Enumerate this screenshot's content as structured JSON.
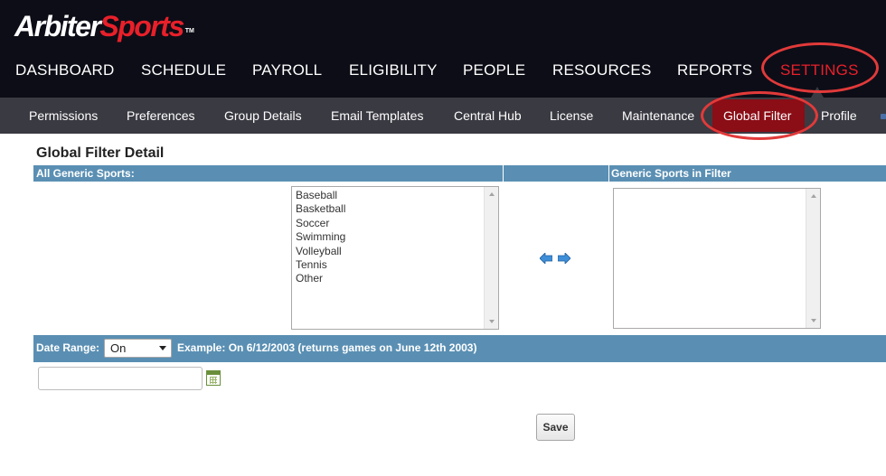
{
  "brand": {
    "part1": "Arbiter",
    "part2": "Sports",
    "tm": "TM"
  },
  "main_nav": [
    {
      "label": "DASHBOARD"
    },
    {
      "label": "SCHEDULE"
    },
    {
      "label": "PAYROLL"
    },
    {
      "label": "ELIGIBILITY"
    },
    {
      "label": "PEOPLE"
    },
    {
      "label": "RESOURCES"
    },
    {
      "label": "REPORTS"
    },
    {
      "label": "SETTINGS",
      "active": true
    }
  ],
  "sub_nav": [
    {
      "label": "Permissions"
    },
    {
      "label": "Preferences"
    },
    {
      "label": "Group Details"
    },
    {
      "label": "Email Templates"
    },
    {
      "label": "Central Hub"
    },
    {
      "label": "License"
    },
    {
      "label": "Maintenance"
    },
    {
      "label": "Global Filter",
      "active": true
    },
    {
      "label": "Profile"
    }
  ],
  "page": {
    "title": "Global Filter Detail",
    "left_header": "All Generic Sports:",
    "right_header": "Generic Sports in Filter",
    "available_sports": [
      "Baseball",
      "Basketball",
      "Soccer",
      "Swimming",
      "Volleyball",
      "Tennis",
      "Other"
    ],
    "filter_sports": [],
    "date_range": {
      "label": "Date Range:",
      "selected": "On",
      "example": "Example: On 6/12/2003 (returns games on June 12th 2003)",
      "value": ""
    },
    "save_label": "Save"
  },
  "colors": {
    "header_bg": "#0d0d17",
    "subnav_bg": "#3a3a42",
    "active_red": "#e8202a",
    "active_pill": "#8b0d16",
    "table_header": "#5a8fb3",
    "highlight_ring": "#e23a3a"
  },
  "icons": {
    "move_left": "arrow-left-icon",
    "move_right": "arrow-right-icon",
    "calendar": "calendar-icon"
  }
}
